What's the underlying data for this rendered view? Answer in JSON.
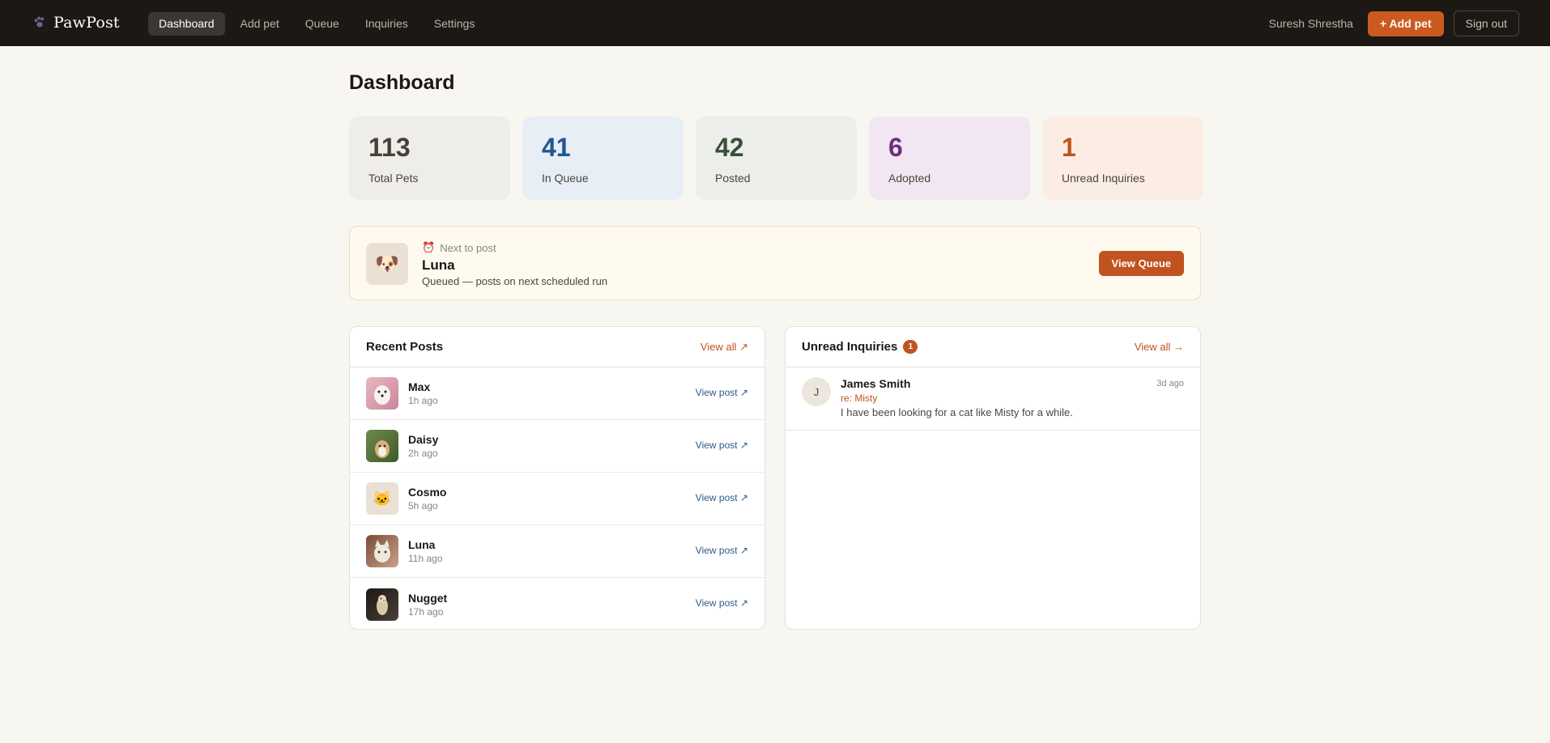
{
  "brand": {
    "name": "PawPost",
    "icon": "paw-icon"
  },
  "nav": {
    "items": [
      {
        "label": "Dashboard",
        "active": true
      },
      {
        "label": "Add pet",
        "active": false
      },
      {
        "label": "Queue",
        "active": false
      },
      {
        "label": "Inquiries",
        "active": false
      },
      {
        "label": "Settings",
        "active": false
      }
    ]
  },
  "user": {
    "name": "Suresh Shrestha"
  },
  "actions": {
    "add_pet": "+ Add pet",
    "sign_out": "Sign out"
  },
  "page": {
    "title": "Dashboard"
  },
  "stats": [
    {
      "value": "113",
      "label": "Total Pets",
      "color": "#4a3f36"
    },
    {
      "value": "41",
      "label": "In Queue",
      "color": "#20578f"
    },
    {
      "value": "42",
      "label": "Posted",
      "color": "#3a4e39"
    },
    {
      "value": "6",
      "label": "Adopted",
      "color": "#6a2f7f"
    },
    {
      "value": "1",
      "label": "Unread Inquiries",
      "color": "#c0531f"
    }
  ],
  "next_post": {
    "icon": "alarm-clock-icon",
    "label": "Next to post",
    "name": "Luna",
    "status": "Queued — posts on next scheduled run",
    "button": "View Queue",
    "thumb_icon": "dog-face-icon"
  },
  "recent_posts": {
    "title": "Recent Posts",
    "view_all": "View all ↗",
    "link_label": "View post ↗",
    "items": [
      {
        "name": "Max",
        "time": "1h ago",
        "thumb": "dog-photo"
      },
      {
        "name": "Daisy",
        "time": "2h ago",
        "thumb": "dog-photo"
      },
      {
        "name": "Cosmo",
        "time": "5h ago",
        "thumb": "cat-face-icon"
      },
      {
        "name": "Luna",
        "time": "11h ago",
        "thumb": "cat-photo"
      },
      {
        "name": "Nugget",
        "time": "17h ago",
        "thumb": "bird-photo"
      }
    ]
  },
  "inquiries": {
    "title": "Unread Inquiries",
    "count": "1",
    "view_all": "View all →",
    "items": [
      {
        "initial": "J",
        "name": "James Smith",
        "re": "re: Misty",
        "message": "I have been looking for a cat like Misty for a while.",
        "time": "3d ago"
      }
    ]
  },
  "colors": {
    "accent": "#c0531f",
    "nav_bg": "#1c1814",
    "page_bg": "#f8f6f1",
    "link": "#2e5a86"
  }
}
